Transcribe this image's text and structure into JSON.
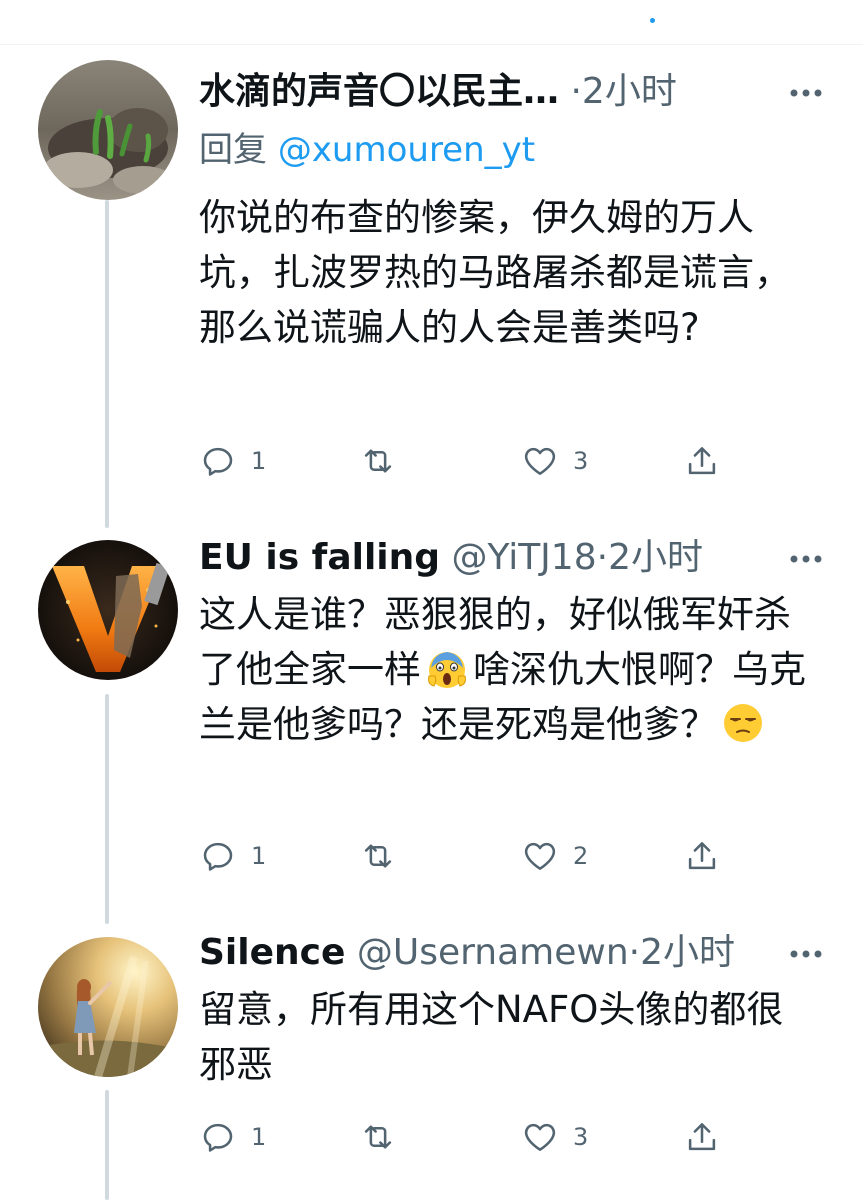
{
  "tweets": [
    {
      "name": "水滴的声音〇以民主…",
      "handle": "",
      "separator": "·",
      "time": "2小时",
      "reply_prefix": "回复",
      "reply_handle": "@xumouren_yt",
      "text": "你说的布查的惨案，伊久姆的万人坑，扎波罗热的马路屠杀都是谎言，那么说谎骗人的人会是善类吗?",
      "reply_count": "1",
      "retweet_count": "",
      "like_count": "3"
    },
    {
      "name": "EU is falling",
      "handle": "@YiTJ18",
      "separator": "·",
      "time": "2小时",
      "text_1": "这人是谁？恶狠狠的，好似俄军奸杀了他全家一样",
      "emoji_1": "scream-emoji",
      "text_2": "啥深仇大恨啊？乌克兰是他爹吗？还是死鸡是他爹？",
      "emoji_2": "unamused-emoji",
      "reply_count": "1",
      "retweet_count": "",
      "like_count": "2"
    },
    {
      "name": "Silence",
      "handle": "@Usernamewn",
      "separator": "·",
      "time": "2小时",
      "text": "留意，所有用这个NAFO头像的都很邪恶",
      "reply_count": "1",
      "retweet_count": "",
      "like_count": "3"
    }
  ],
  "icons": {
    "reply": "reply-icon",
    "retweet": "retweet-icon",
    "like": "heart-icon",
    "share": "share-icon",
    "more": "more-icon"
  },
  "colors": {
    "text": "#0f1419",
    "secondary": "#536471",
    "accent": "#1d9bf0",
    "thread_line": "#cfd9de"
  }
}
